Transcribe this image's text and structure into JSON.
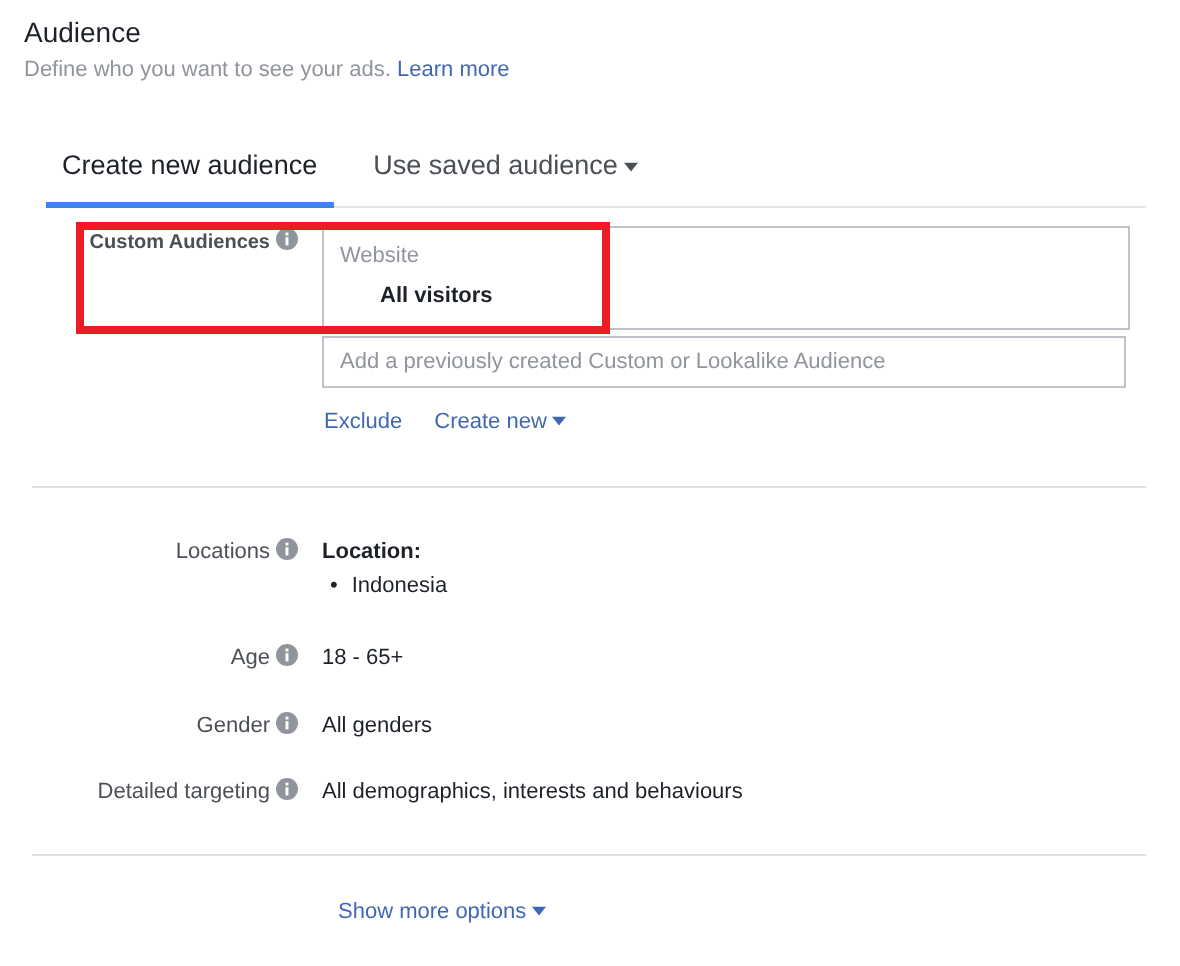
{
  "header": {
    "title": "Audience",
    "subtitle": "Define who you want to see your ads.",
    "link": "Learn more"
  },
  "tabs": [
    {
      "label": "Create new audience",
      "selected": true,
      "dropdown": false
    },
    {
      "label": "Use saved audience",
      "selected": false,
      "dropdown": true
    }
  ],
  "custom_audiences": {
    "label": "Custom Audiences",
    "highlighted": true,
    "group": "Website",
    "item": "All visitors",
    "placeholder": "Add a previously created Custom or Lookalike Audience",
    "links": [
      {
        "label": "Exclude",
        "dropdown": false
      },
      {
        "label": "Create new",
        "dropdown": true
      }
    ]
  },
  "fields": [
    {
      "label": "Locations",
      "kind": "list",
      "heading": "Location:",
      "bullet": "•",
      "items": [
        "Indonesia"
      ]
    },
    {
      "label": "Age",
      "kind": "text",
      "value": "18 - 65+"
    },
    {
      "label": "Gender",
      "kind": "text",
      "value": "All genders"
    },
    {
      "label": "Detailed targeting",
      "kind": "text",
      "value": "All demographics, interests and behaviours"
    }
  ],
  "more": {
    "label": "Show more options"
  }
}
